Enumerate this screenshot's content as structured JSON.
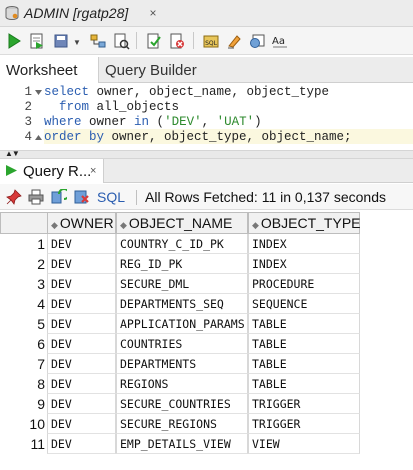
{
  "window": {
    "title": "ADMIN [rgatp28]",
    "close_glyph": "×"
  },
  "toolbar": {
    "buttons": [
      "run-statement-icon",
      "run-script-icon",
      "commit-icon",
      "explain-plan-icon",
      "autotrace-icon",
      "sql-tuning-icon",
      "rollback-icon",
      "sql-history-icon",
      "clear-icon",
      "format-icon",
      "to-upper-icon"
    ]
  },
  "worksheet_tabs": [
    {
      "label": "Worksheet",
      "active": true
    },
    {
      "label": "Query Builder",
      "active": false
    }
  ],
  "editor": {
    "line_numbers": [
      "1",
      "2",
      "3",
      "4"
    ],
    "lines": [
      [
        {
          "t": "select ",
          "k": "kw"
        },
        {
          "t": "owner, object_name, object_type",
          "k": ""
        }
      ],
      [
        {
          "t": "  from ",
          "k": "kw"
        },
        {
          "t": "all_objects",
          "k": ""
        }
      ],
      [
        {
          "t": "where ",
          "k": "kw"
        },
        {
          "t": "owner ",
          "k": ""
        },
        {
          "t": "in ",
          "k": "kw"
        },
        {
          "t": "(",
          "k": ""
        },
        {
          "t": "'DEV'",
          "k": "str"
        },
        {
          "t": ", ",
          "k": ""
        },
        {
          "t": "'UAT'",
          "k": "str"
        },
        {
          "t": ")",
          "k": ""
        }
      ],
      [
        {
          "t": "order by ",
          "k": "kw"
        },
        {
          "t": "owner, object_type, object_name;",
          "k": ""
        }
      ]
    ]
  },
  "results_tab": {
    "label": "Query R...",
    "close_glyph": "×"
  },
  "results_toolbar": {
    "sql_label": "SQL",
    "fetch_message": "All Rows Fetched: 11 in 0,137 seconds"
  },
  "grid": {
    "columns": [
      "OWNER",
      "OBJECT_NAME",
      "OBJECT_TYPE"
    ],
    "rows": [
      [
        "1",
        "DEV",
        "COUNTRY_C_ID_PK",
        "INDEX"
      ],
      [
        "2",
        "DEV",
        "REG_ID_PK",
        "INDEX"
      ],
      [
        "3",
        "DEV",
        "SECURE_DML",
        "PROCEDURE"
      ],
      [
        "4",
        "DEV",
        "DEPARTMENTS_SEQ",
        "SEQUENCE"
      ],
      [
        "5",
        "DEV",
        "APPLICATION_PARAMS",
        "TABLE"
      ],
      [
        "6",
        "DEV",
        "COUNTRIES",
        "TABLE"
      ],
      [
        "7",
        "DEV",
        "DEPARTMENTS",
        "TABLE"
      ],
      [
        "8",
        "DEV",
        "REGIONS",
        "TABLE"
      ],
      [
        "9",
        "DEV",
        "SECURE_COUNTRIES",
        "TRIGGER"
      ],
      [
        "10",
        "DEV",
        "SECURE_REGIONS",
        "TRIGGER"
      ],
      [
        "11",
        "DEV",
        "EMP_DETAILS_VIEW",
        "VIEW"
      ]
    ]
  },
  "colors": {
    "keyword": "#2a5db0",
    "string": "#2d8a2d",
    "current_line": "#fbf8df"
  }
}
